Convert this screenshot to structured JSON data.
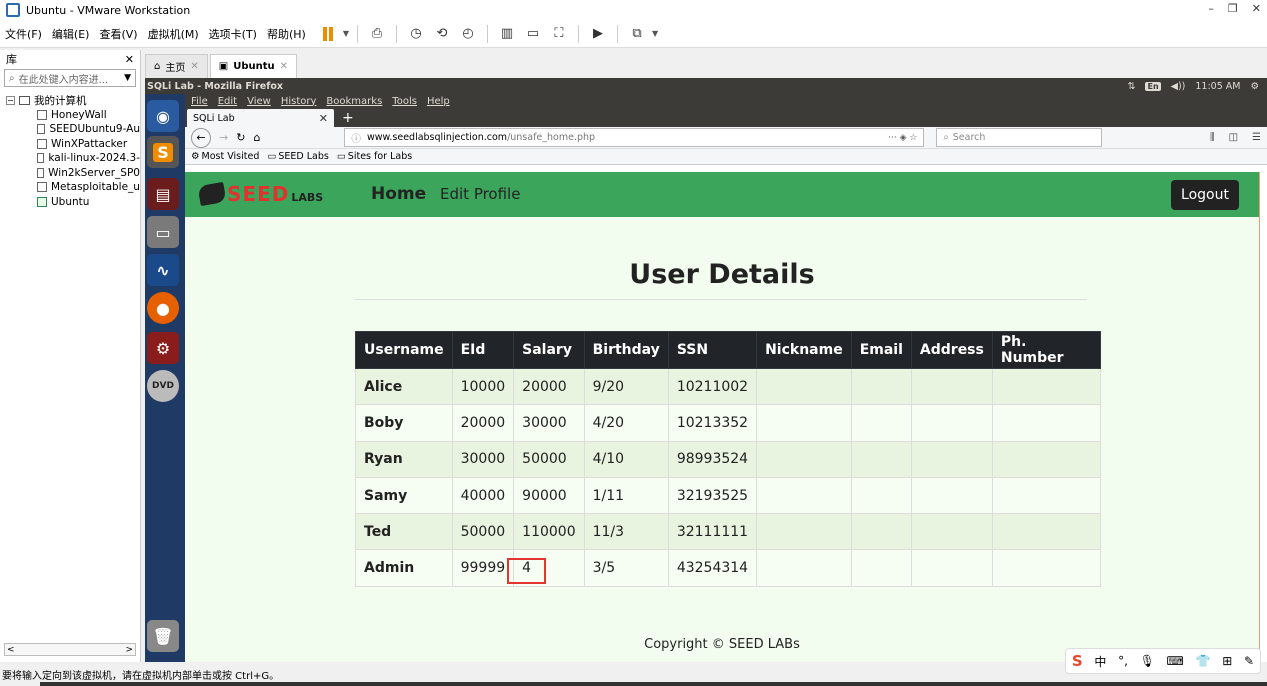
{
  "vm": {
    "title": "Ubuntu - VMware Workstation",
    "menu": [
      "文件(F)",
      "编辑(E)",
      "查看(V)",
      "虚拟机(M)",
      "选项卡(T)",
      "帮助(H)"
    ],
    "library_label": "库",
    "search_placeholder": "在此处键入内容进...",
    "tree_root": "我的计算机",
    "vms": [
      "HoneyWall",
      "SEEDUbuntu9-Au",
      "WinXPattacker",
      "kali-linux-2024.3-",
      "Win2kServer_SP0",
      "Metasploitable_u",
      "Ubuntu"
    ],
    "tabs": [
      {
        "label": "主页"
      },
      {
        "label": "Ubuntu"
      }
    ],
    "status_text": "要将输入定向到该虚拟机，请在虚拟机内部单击或按 Ctrl+G。"
  },
  "ubuntu": {
    "window_title": "SQLi Lab - Mozilla Firefox",
    "lang": "En",
    "volume": "◀))",
    "time": "11:05 AM"
  },
  "firefox": {
    "menu": [
      "File",
      "Edit",
      "View",
      "History",
      "Bookmarks",
      "Tools",
      "Help"
    ],
    "tab_title": "SQLi Lab",
    "url_host": "www.seedlabsqlinjection.com",
    "url_path": "/unsafe_home.php",
    "search_placeholder": "Search",
    "bookmarks": [
      "Most Visited",
      "SEED Labs",
      "Sites for Labs"
    ]
  },
  "page": {
    "logo_text": "SEED",
    "logo_sub": "LABS",
    "nav": [
      "Home",
      "Edit Profile"
    ],
    "logout": "Logout",
    "title": "User Details",
    "columns": [
      "Username",
      "EId",
      "Salary",
      "Birthday",
      "SSN",
      "Nickname",
      "Email",
      "Address",
      "Ph. Number"
    ],
    "rows": [
      {
        "Username": "Alice",
        "EId": "10000",
        "Salary": "20000",
        "Birthday": "9/20",
        "SSN": "10211002",
        "Nickname": "",
        "Email": "",
        "Address": "",
        "Ph": ""
      },
      {
        "Username": "Boby",
        "EId": "20000",
        "Salary": "30000",
        "Birthday": "4/20",
        "SSN": "10213352",
        "Nickname": "",
        "Email": "",
        "Address": "",
        "Ph": ""
      },
      {
        "Username": "Ryan",
        "EId": "30000",
        "Salary": "50000",
        "Birthday": "4/10",
        "SSN": "98993524",
        "Nickname": "",
        "Email": "",
        "Address": "",
        "Ph": ""
      },
      {
        "Username": "Samy",
        "EId": "40000",
        "Salary": "90000",
        "Birthday": "1/11",
        "SSN": "32193525",
        "Nickname": "",
        "Email": "",
        "Address": "",
        "Ph": ""
      },
      {
        "Username": "Ted",
        "EId": "50000",
        "Salary": "110000",
        "Birthday": "11/3",
        "SSN": "32111111",
        "Nickname": "",
        "Email": "",
        "Address": "",
        "Ph": ""
      },
      {
        "Username": "Admin",
        "EId": "99999",
        "Salary": "4",
        "Birthday": "3/5",
        "SSN": "43254314",
        "Nickname": "",
        "Email": "",
        "Address": "",
        "Ph": ""
      }
    ],
    "copyright": "Copyright © SEED LABs",
    "colors": {
      "navbar": "#3ba55c",
      "highlight": "#e3342f",
      "background": "#f3fdef"
    }
  },
  "ime": {
    "lang": "中"
  }
}
